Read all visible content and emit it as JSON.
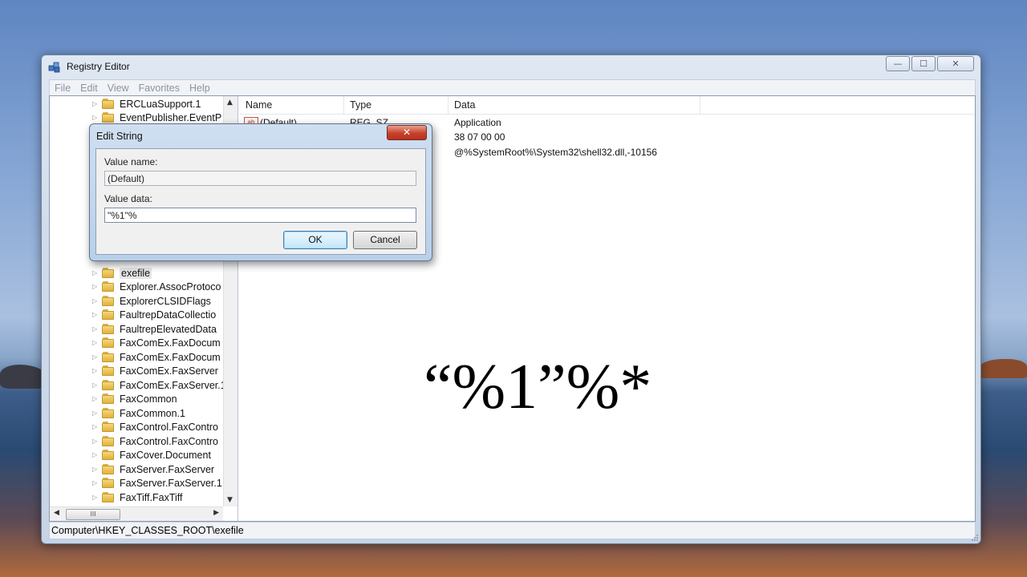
{
  "window": {
    "title": "Registry Editor",
    "controls": {
      "minimize": "—",
      "maximize": "☐",
      "close": "✕"
    }
  },
  "menu": [
    "File",
    "Edit",
    "View",
    "Favorites",
    "Help"
  ],
  "tree": {
    "items": [
      {
        "label": "ERCLuaSupport.1"
      },
      {
        "label": "EventPublisher.EventP"
      },
      {
        "label": "exefile",
        "selected": true
      },
      {
        "label": "Explorer.AssocProtoco"
      },
      {
        "label": "ExplorerCLSIDFlags"
      },
      {
        "label": "FaultrepDataCollectio"
      },
      {
        "label": "FaultrepElevatedData"
      },
      {
        "label": "FaxComEx.FaxDocum"
      },
      {
        "label": "FaxComEx.FaxDocum"
      },
      {
        "label": "FaxComEx.FaxServer"
      },
      {
        "label": "FaxComEx.FaxServer.1"
      },
      {
        "label": "FaxCommon"
      },
      {
        "label": "FaxCommon.1"
      },
      {
        "label": "FaxControl.FaxContro"
      },
      {
        "label": "FaxControl.FaxContro"
      },
      {
        "label": "FaxCover.Document"
      },
      {
        "label": "FaxServer.FaxServer"
      },
      {
        "label": "FaxServer.FaxServer.1"
      },
      {
        "label": "FaxTiff.FaxTiff"
      }
    ],
    "hscroll_thumb": "III"
  },
  "list": {
    "columns": [
      "Name",
      "Type",
      "Data"
    ],
    "rows": [
      {
        "name": "(Default)",
        "type": "REG_SZ",
        "data": "Application",
        "icon": "ab"
      },
      {
        "name": "",
        "type": "",
        "data": "38 07 00 00"
      },
      {
        "name": "",
        "type": "",
        "data": "@%SystemRoot%\\System32\\shell32.dll,-10156"
      }
    ]
  },
  "overlay_text": "“%1”%*",
  "status": {
    "path": "Computer\\HKEY_CLASSES_ROOT\\exefile"
  },
  "dialog": {
    "title": "Edit String",
    "close": "✕",
    "value_name_label": "Value name:",
    "value_name": "(Default)",
    "value_data_label": "Value data:",
    "value_data": "\"%1\"%",
    "ok": "OK",
    "cancel": "Cancel"
  }
}
